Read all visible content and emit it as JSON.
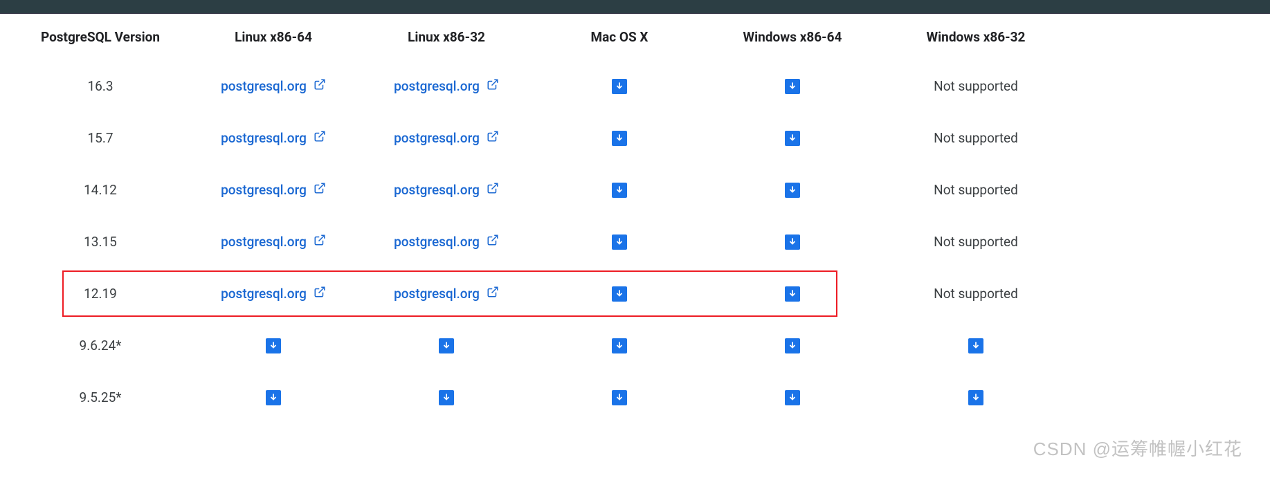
{
  "headers": [
    "PostgreSQL Version",
    "Linux x86-64",
    "Linux x86-32",
    "Mac OS X",
    "Windows x86-64",
    "Windows x86-32"
  ],
  "link_text": "postgresql.org",
  "not_supported": "Not supported",
  "rows": [
    {
      "version": "16.3",
      "cells": [
        "link",
        "link",
        "dl",
        "dl",
        "ns"
      ]
    },
    {
      "version": "15.7",
      "cells": [
        "link",
        "link",
        "dl",
        "dl",
        "ns"
      ]
    },
    {
      "version": "14.12",
      "cells": [
        "link",
        "link",
        "dl",
        "dl",
        "ns"
      ]
    },
    {
      "version": "13.15",
      "cells": [
        "link",
        "link",
        "dl",
        "dl",
        "ns"
      ]
    },
    {
      "version": "12.19",
      "cells": [
        "link",
        "link",
        "dl",
        "dl",
        "ns"
      ],
      "highlight": true
    },
    {
      "version": "9.6.24*",
      "cells": [
        "dl",
        "dl",
        "dl",
        "dl",
        "dl"
      ]
    },
    {
      "version": "9.5.25*",
      "cells": [
        "dl",
        "dl",
        "dl",
        "dl",
        "dl"
      ]
    }
  ],
  "watermark": "CSDN @运筹帷幄小红花"
}
